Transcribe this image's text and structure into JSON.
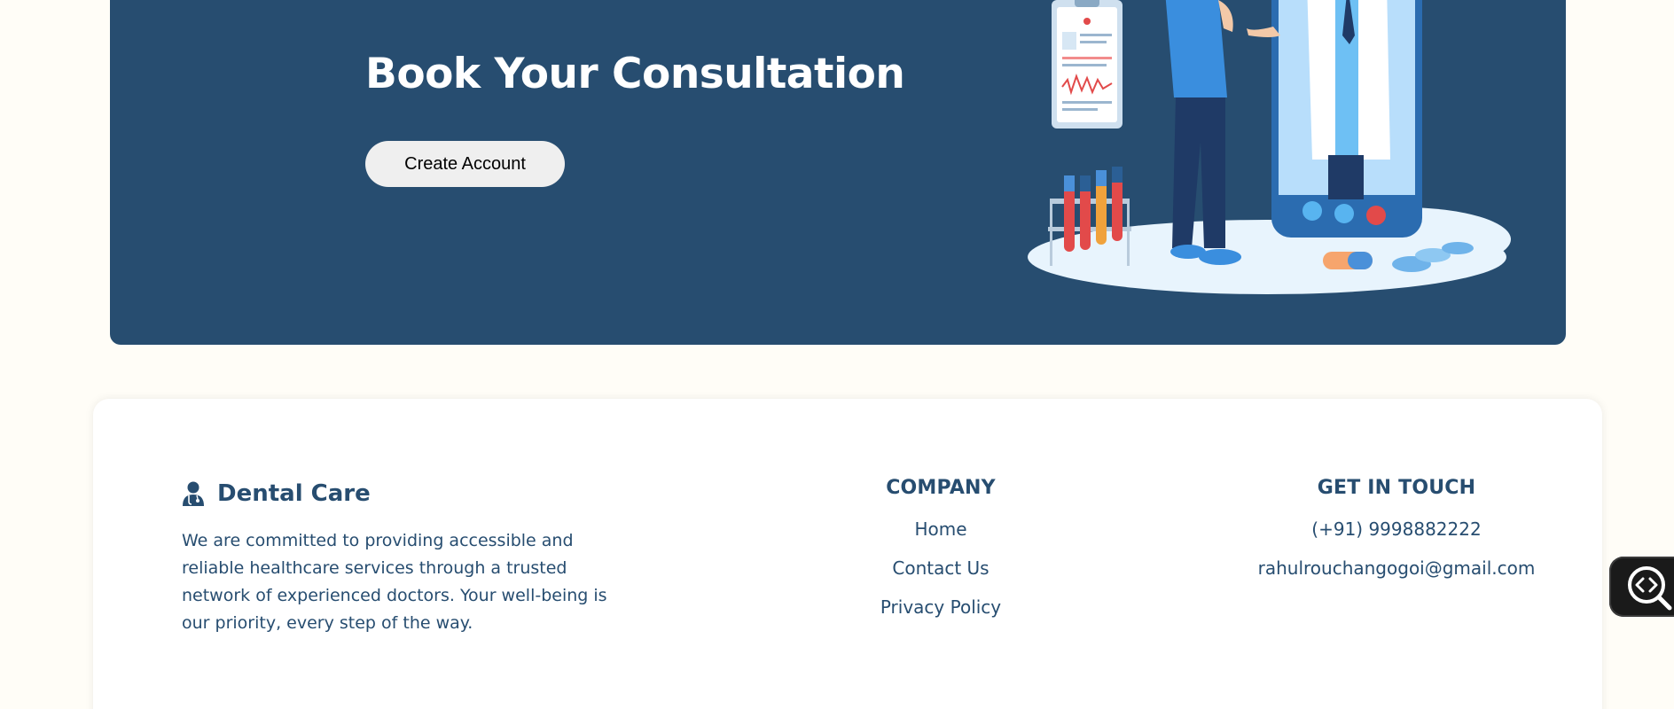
{
  "banner": {
    "title": "Book Your Consultation",
    "cta_label": "Create Account",
    "background_color": "#274d70"
  },
  "footer": {
    "brand": {
      "name": "Dental Care",
      "icon": "doctor-icon",
      "description": "We are committed to providing accessible and reliable healthcare services through a trusted network of experienced doctors. Your well-being is our priority, every step of the way."
    },
    "company": {
      "heading": "COMPANY",
      "links": [
        "Home",
        "Contact Us",
        "Privacy Policy"
      ]
    },
    "contact": {
      "heading": "GET IN TOUCH",
      "phone": "(+91) 9998882222",
      "email": "rahulrouchangogoi@gmail.com"
    },
    "text_color": "#274d70"
  },
  "floating_tool": {
    "icon": "code-search-icon"
  }
}
